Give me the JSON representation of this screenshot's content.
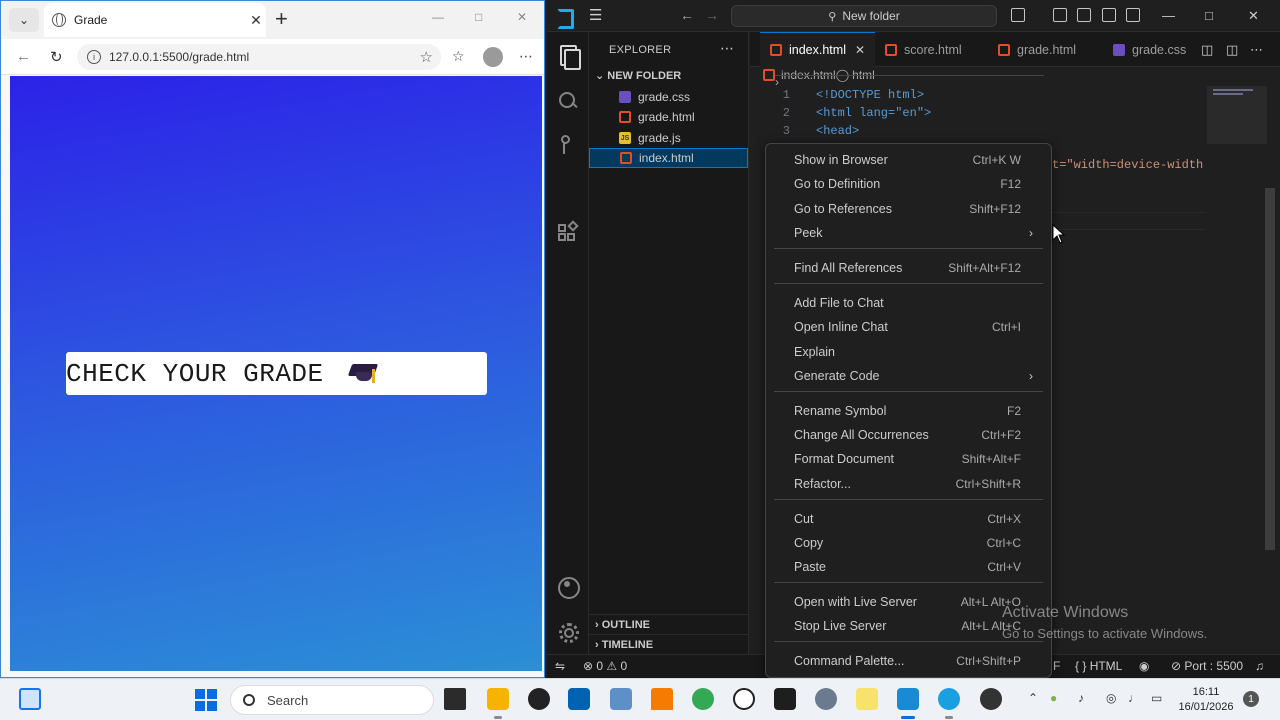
{
  "browser": {
    "tab_title": "Grade",
    "url": "127.0.0.1:5500/grade.html",
    "page_heading": "CHECK YOUR GRADE",
    "heading_emoji": "graduation-cap"
  },
  "vscode": {
    "search_placeholder": "New folder",
    "explorer": {
      "title": "EXPLORER",
      "folder": "NEW FOLDER",
      "files": [
        {
          "name": "grade.css",
          "type": "css"
        },
        {
          "name": "grade.html",
          "type": "html"
        },
        {
          "name": "grade.js",
          "type": "js"
        },
        {
          "name": "index.html",
          "type": "html",
          "selected": true
        }
      ],
      "outline": "OUTLINE",
      "timeline": "TIMELINE"
    },
    "tabs": [
      {
        "name": "index.html",
        "type": "html",
        "active": true
      },
      {
        "name": "score.html",
        "type": "html"
      },
      {
        "name": "grade.html",
        "type": "html"
      },
      {
        "name": "grade.css",
        "type": "css"
      }
    ],
    "breadcrumb": {
      "file": "index.html",
      "symbol": "html"
    },
    "code_lines": [
      {
        "num": "1",
        "text": "<!DOCTYPE html>"
      },
      {
        "num": "2",
        "text": "<html lang=\"en\">"
      },
      {
        "num": "3",
        "text": "<head>"
      }
    ],
    "code_fragment": "t=\"width=device-width",
    "status": {
      "errors": "0",
      "warnings": "0",
      "language_fragment": "F",
      "language": "HTML",
      "port": "Port : 5500"
    }
  },
  "context_menu": [
    {
      "label": "Show in Browser",
      "shortcut": "Ctrl+K W"
    },
    {
      "label": "Go to Definition",
      "shortcut": "F12"
    },
    {
      "label": "Go to References",
      "shortcut": "Shift+F12"
    },
    {
      "label": "Peek",
      "shortcut": "",
      "submenu": true
    },
    {
      "label": "Find All References",
      "shortcut": "Shift+Alt+F12"
    },
    {
      "label": "Add File to Chat",
      "shortcut": ""
    },
    {
      "label": "Open Inline Chat",
      "shortcut": "Ctrl+I"
    },
    {
      "label": "Explain",
      "shortcut": ""
    },
    {
      "label": "Generate Code",
      "shortcut": "",
      "submenu": true
    },
    {
      "label": "Rename Symbol",
      "shortcut": "F2"
    },
    {
      "label": "Change All Occurrences",
      "shortcut": "Ctrl+F2"
    },
    {
      "label": "Format Document",
      "shortcut": "Shift+Alt+F"
    },
    {
      "label": "Refactor...",
      "shortcut": "Ctrl+Shift+R"
    },
    {
      "label": "Cut",
      "shortcut": "Ctrl+X"
    },
    {
      "label": "Copy",
      "shortcut": "Ctrl+C"
    },
    {
      "label": "Paste",
      "shortcut": "Ctrl+V"
    },
    {
      "label": "Open with Live Server",
      "shortcut": "Alt+L Alt+O"
    },
    {
      "label": "Stop Live Server",
      "shortcut": "Alt+L Alt+C"
    },
    {
      "label": "Command Palette...",
      "shortcut": "Ctrl+Shift+P"
    }
  ],
  "watermark": {
    "line1": "Activate Windows",
    "line2": "Go to Settings to activate Windows."
  },
  "taskbar": {
    "search_label": "Search",
    "time": "16:11",
    "date": "16/01/2026",
    "notifications": "1"
  }
}
